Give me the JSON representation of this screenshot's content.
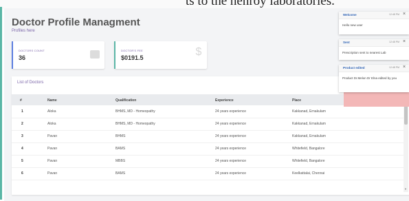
{
  "top_text": "ts to the henroy laboratories.",
  "page": {
    "title": "Doctor Profile Managment",
    "subtitle": "Profiles here"
  },
  "cards": [
    {
      "label": "DOCTORS COUNT",
      "value": "36",
      "icon": "id-card-icon"
    },
    {
      "label": "DOCTOR'S FEE",
      "value": "$0191.5",
      "icon": "dollar-icon"
    }
  ],
  "list": {
    "title": "List of Doctors",
    "headers": [
      "#",
      "Name",
      "Qualification",
      "Experience",
      "Place"
    ],
    "rows": [
      [
        "1",
        "Aloka",
        "BHMS, MD - Homeopathy",
        "24 years experience",
        "Kakkanad, Ernakulam"
      ],
      [
        "2",
        "Aloka",
        "BHMS, MD - Homeopathy",
        "24 years experience",
        "Kakkanad, Ernakulam"
      ],
      [
        "3",
        "Pavan",
        "BHMS",
        "24 years experience",
        "Kakkanad, Ernakulam"
      ],
      [
        "4",
        "Pavan",
        "BAMS",
        "24 years experience",
        "Whitefield, Bangalore"
      ],
      [
        "5",
        "Pavan",
        "MBBS",
        "24 years experience",
        "Whitefield, Bangalore"
      ],
      [
        "6",
        "Pavan",
        "BAMS",
        "24 years experience",
        "Keelkattalai, Chennai"
      ]
    ]
  },
  "toasts": [
    {
      "title": "Welcome",
      "time": "12:48 PM",
      "body": "Hello new user"
    },
    {
      "title": "Sent",
      "time": "12:48 PM",
      "body": "Prescription sent to nearest Lab"
    },
    {
      "title": "Product edited",
      "time": "12:48 PM",
      "body": "Product Dr.Melon Dr Elna edited by you"
    }
  ],
  "colors": {
    "accent_teal": "#5ab6a6",
    "accent_blue": "#5c7ee0",
    "label_purple": "#7a64a8",
    "toast_title_blue": "#2f63b5",
    "error_red": "#f3b7b7"
  }
}
